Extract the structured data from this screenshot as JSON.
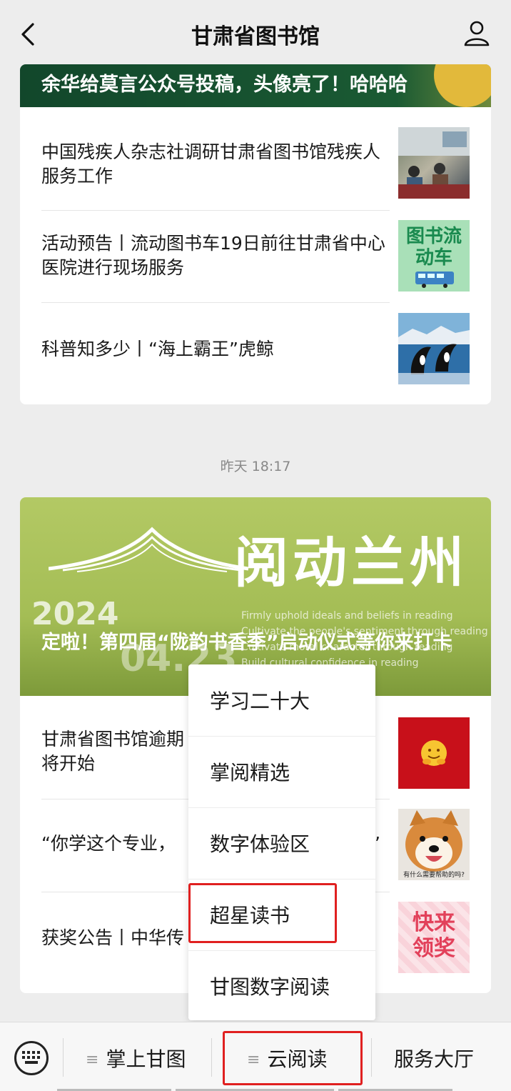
{
  "header": {
    "title": "甘肃省图书馆"
  },
  "feed": {
    "card1": {
      "banner_title": "余华给莫言公众号投稿，头像亮了！哈哈哈",
      "items": [
        {
          "title": "中国残疾人杂志社调研甘肃省图书馆残疾人服务工作",
          "thumb": "classroom-photo"
        },
        {
          "title": "活动预告丨流动图书车19日前往甘肃省中心医院进行现场服务",
          "thumb": "bus-graphic",
          "thumb_text": "图书流动车"
        },
        {
          "title": "科普知多少丨“海上霸王”虎鲸",
          "thumb": "orca-photo"
        }
      ]
    },
    "timestamp": "昨天 18:17",
    "card2": {
      "banner": {
        "big_title": "阅动兰州",
        "year": "2024",
        "date_ghost": "04.23",
        "english_lines": [
          "Firmly uphold ideals and beliefs in reading",
          "Cultivate the people's sentiment through reading",
          "Cultivate moral character through reading",
          "Build cultural confidence in reading"
        ],
        "caption": "定啦！第四届“陇韵书香季”启动仪式等你来打卡"
      },
      "items": [
        {
          "title": "甘肃省图书馆逾期将开始",
          "thumb": "red-emoji"
        },
        {
          "title": "“你学这个专业，",
          "tail": "”",
          "thumb": "dog-photo",
          "thumb_caption": "有什么需要帮助的吗?"
        },
        {
          "title": "获奖公告丨中华传",
          "thumb": "prize-graphic",
          "thumb_text": "快来领奖"
        }
      ]
    }
  },
  "popup_menu": {
    "items": [
      "学习二十大",
      "掌阅精选",
      "数字体验区",
      "超星读书",
      "甘图数字阅读"
    ],
    "highlighted": "超星读书"
  },
  "bottom_menu": {
    "tabs": [
      "掌上甘图",
      "云阅读",
      "服务大厅"
    ],
    "active": "云阅读"
  },
  "colors": {
    "highlight": "#e02020",
    "card1_banner": "#12472b",
    "card2_banner": "#a4bd55"
  }
}
